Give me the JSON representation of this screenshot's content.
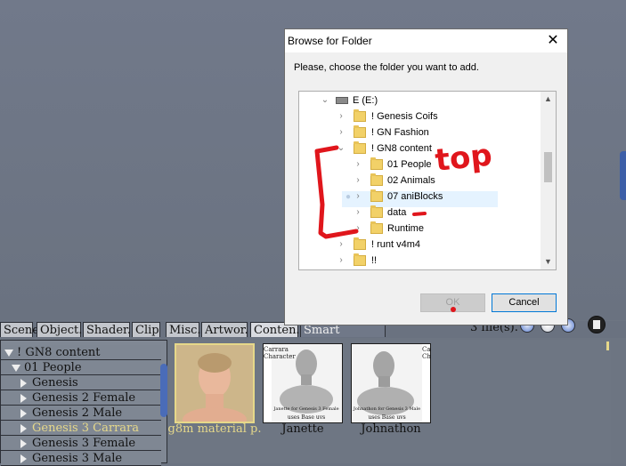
{
  "tabs": [
    {
      "label": "Scene."
    },
    {
      "label": "Object."
    },
    {
      "label": "Shader."
    },
    {
      "label": "Clip"
    },
    {
      "label": "Misc."
    },
    {
      "label": "Artwor."
    },
    {
      "label": "Conten."
    },
    {
      "label": "Smart Content"
    }
  ],
  "files_count": "3 file(s).",
  "tree": {
    "items": [
      {
        "label": "! GN8 content",
        "expanded": true
      },
      {
        "label": "01 People",
        "expanded": true
      },
      {
        "label": "Genesis"
      },
      {
        "label": "Genesis 2 Female"
      },
      {
        "label": "Genesis 2 Male"
      },
      {
        "label": "Genesis 3 Carrara",
        "selected": true
      },
      {
        "label": "Genesis 3 Female"
      },
      {
        "label": "Genesis 3 Male"
      }
    ]
  },
  "thumbnails": [
    {
      "label": "g8m material p.",
      "selected": true,
      "caption": ""
    },
    {
      "label": "Janette",
      "side_text": "Carrara Character",
      "caption": "Janette for Genesis 3 Female",
      "caption2": "uses Base uvs"
    },
    {
      "label": "Johnathon",
      "side_text": "Carrara Character",
      "caption": "Johnathon for Genesis 3 Male",
      "caption2": "uses Base uvs"
    }
  ],
  "dialog": {
    "title": "Browse for Folder",
    "instruction": "Please, choose the folder you want to add.",
    "ok_label": "OK",
    "cancel_label": "Cancel",
    "tree": [
      {
        "label": "E (E:)",
        "indent": 0,
        "chevron": "down",
        "icon": "drive"
      },
      {
        "label": "! Genesis Coifs",
        "indent": 1,
        "chevron": "right",
        "icon": "folder"
      },
      {
        "label": "! GN Fashion",
        "indent": 1,
        "chevron": "right",
        "icon": "folder"
      },
      {
        "label": "! GN8 content",
        "indent": 1,
        "chevron": "down",
        "icon": "folder"
      },
      {
        "label": "01 People",
        "indent": 2,
        "chevron": "right",
        "icon": "folder"
      },
      {
        "label": "02 Animals",
        "indent": 2,
        "chevron": "right",
        "icon": "folder"
      },
      {
        "label": "07 aniBlocks",
        "indent": 2,
        "chevron": "right",
        "icon": "folder"
      },
      {
        "label": "data",
        "indent": 2,
        "chevron": "right",
        "icon": "folder"
      },
      {
        "label": "Runtime",
        "indent": 2,
        "chevron": "right",
        "icon": "folder"
      },
      {
        "label": "! runt v4m4",
        "indent": 1,
        "chevron": "right",
        "icon": "folder"
      },
      {
        "label": "!!",
        "indent": 1,
        "chevron": "right",
        "icon": "folder"
      }
    ]
  },
  "annotation": {
    "text": "top",
    "color": "#e0161c"
  }
}
